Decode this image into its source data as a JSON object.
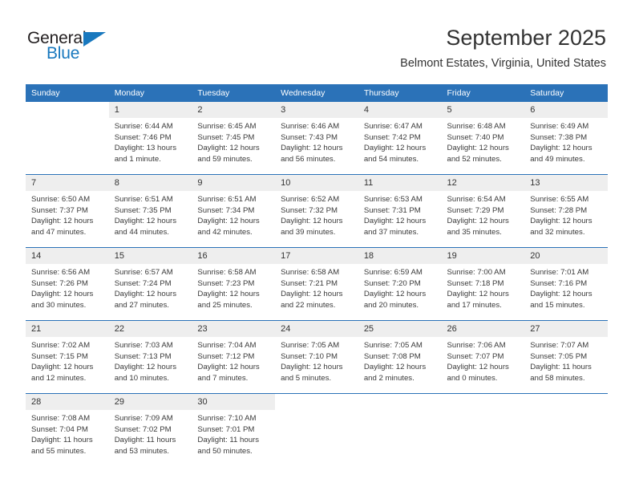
{
  "brand": {
    "name_top": "General",
    "name_bottom": "Blue",
    "triangle_icon": "triangle-logo-icon",
    "color_black": "#231f20",
    "color_blue": "#1878be"
  },
  "header": {
    "title": "September 2025",
    "subtitle": "Belmont Estates, Virginia, United States"
  },
  "theme": {
    "header_bg": "#2b72b8",
    "header_text": "#ffffff",
    "daynum_bg": "#eeeeee",
    "body_text": "#3a3a3a"
  },
  "weekday_headers": [
    "Sunday",
    "Monday",
    "Tuesday",
    "Wednesday",
    "Thursday",
    "Friday",
    "Saturday"
  ],
  "weeks": [
    [
      {
        "day": "",
        "blank": true
      },
      {
        "day": "1",
        "sunrise": "Sunrise: 6:44 AM",
        "sunset": "Sunset: 7:46 PM",
        "daylight_line1": "Daylight: 13 hours",
        "daylight_line2": "and 1 minute."
      },
      {
        "day": "2",
        "sunrise": "Sunrise: 6:45 AM",
        "sunset": "Sunset: 7:45 PM",
        "daylight_line1": "Daylight: 12 hours",
        "daylight_line2": "and 59 minutes."
      },
      {
        "day": "3",
        "sunrise": "Sunrise: 6:46 AM",
        "sunset": "Sunset: 7:43 PM",
        "daylight_line1": "Daylight: 12 hours",
        "daylight_line2": "and 56 minutes."
      },
      {
        "day": "4",
        "sunrise": "Sunrise: 6:47 AM",
        "sunset": "Sunset: 7:42 PM",
        "daylight_line1": "Daylight: 12 hours",
        "daylight_line2": "and 54 minutes."
      },
      {
        "day": "5",
        "sunrise": "Sunrise: 6:48 AM",
        "sunset": "Sunset: 7:40 PM",
        "daylight_line1": "Daylight: 12 hours",
        "daylight_line2": "and 52 minutes."
      },
      {
        "day": "6",
        "sunrise": "Sunrise: 6:49 AM",
        "sunset": "Sunset: 7:38 PM",
        "daylight_line1": "Daylight: 12 hours",
        "daylight_line2": "and 49 minutes."
      }
    ],
    [
      {
        "day": "7",
        "sunrise": "Sunrise: 6:50 AM",
        "sunset": "Sunset: 7:37 PM",
        "daylight_line1": "Daylight: 12 hours",
        "daylight_line2": "and 47 minutes."
      },
      {
        "day": "8",
        "sunrise": "Sunrise: 6:51 AM",
        "sunset": "Sunset: 7:35 PM",
        "daylight_line1": "Daylight: 12 hours",
        "daylight_line2": "and 44 minutes."
      },
      {
        "day": "9",
        "sunrise": "Sunrise: 6:51 AM",
        "sunset": "Sunset: 7:34 PM",
        "daylight_line1": "Daylight: 12 hours",
        "daylight_line2": "and 42 minutes."
      },
      {
        "day": "10",
        "sunrise": "Sunrise: 6:52 AM",
        "sunset": "Sunset: 7:32 PM",
        "daylight_line1": "Daylight: 12 hours",
        "daylight_line2": "and 39 minutes."
      },
      {
        "day": "11",
        "sunrise": "Sunrise: 6:53 AM",
        "sunset": "Sunset: 7:31 PM",
        "daylight_line1": "Daylight: 12 hours",
        "daylight_line2": "and 37 minutes."
      },
      {
        "day": "12",
        "sunrise": "Sunrise: 6:54 AM",
        "sunset": "Sunset: 7:29 PM",
        "daylight_line1": "Daylight: 12 hours",
        "daylight_line2": "and 35 minutes."
      },
      {
        "day": "13",
        "sunrise": "Sunrise: 6:55 AM",
        "sunset": "Sunset: 7:28 PM",
        "daylight_line1": "Daylight: 12 hours",
        "daylight_line2": "and 32 minutes."
      }
    ],
    [
      {
        "day": "14",
        "sunrise": "Sunrise: 6:56 AM",
        "sunset": "Sunset: 7:26 PM",
        "daylight_line1": "Daylight: 12 hours",
        "daylight_line2": "and 30 minutes."
      },
      {
        "day": "15",
        "sunrise": "Sunrise: 6:57 AM",
        "sunset": "Sunset: 7:24 PM",
        "daylight_line1": "Daylight: 12 hours",
        "daylight_line2": "and 27 minutes."
      },
      {
        "day": "16",
        "sunrise": "Sunrise: 6:58 AM",
        "sunset": "Sunset: 7:23 PM",
        "daylight_line1": "Daylight: 12 hours",
        "daylight_line2": "and 25 minutes."
      },
      {
        "day": "17",
        "sunrise": "Sunrise: 6:58 AM",
        "sunset": "Sunset: 7:21 PM",
        "daylight_line1": "Daylight: 12 hours",
        "daylight_line2": "and 22 minutes."
      },
      {
        "day": "18",
        "sunrise": "Sunrise: 6:59 AM",
        "sunset": "Sunset: 7:20 PM",
        "daylight_line1": "Daylight: 12 hours",
        "daylight_line2": "and 20 minutes."
      },
      {
        "day": "19",
        "sunrise": "Sunrise: 7:00 AM",
        "sunset": "Sunset: 7:18 PM",
        "daylight_line1": "Daylight: 12 hours",
        "daylight_line2": "and 17 minutes."
      },
      {
        "day": "20",
        "sunrise": "Sunrise: 7:01 AM",
        "sunset": "Sunset: 7:16 PM",
        "daylight_line1": "Daylight: 12 hours",
        "daylight_line2": "and 15 minutes."
      }
    ],
    [
      {
        "day": "21",
        "sunrise": "Sunrise: 7:02 AM",
        "sunset": "Sunset: 7:15 PM",
        "daylight_line1": "Daylight: 12 hours",
        "daylight_line2": "and 12 minutes."
      },
      {
        "day": "22",
        "sunrise": "Sunrise: 7:03 AM",
        "sunset": "Sunset: 7:13 PM",
        "daylight_line1": "Daylight: 12 hours",
        "daylight_line2": "and 10 minutes."
      },
      {
        "day": "23",
        "sunrise": "Sunrise: 7:04 AM",
        "sunset": "Sunset: 7:12 PM",
        "daylight_line1": "Daylight: 12 hours",
        "daylight_line2": "and 7 minutes."
      },
      {
        "day": "24",
        "sunrise": "Sunrise: 7:05 AM",
        "sunset": "Sunset: 7:10 PM",
        "daylight_line1": "Daylight: 12 hours",
        "daylight_line2": "and 5 minutes."
      },
      {
        "day": "25",
        "sunrise": "Sunrise: 7:05 AM",
        "sunset": "Sunset: 7:08 PM",
        "daylight_line1": "Daylight: 12 hours",
        "daylight_line2": "and 2 minutes."
      },
      {
        "day": "26",
        "sunrise": "Sunrise: 7:06 AM",
        "sunset": "Sunset: 7:07 PM",
        "daylight_line1": "Daylight: 12 hours",
        "daylight_line2": "and 0 minutes."
      },
      {
        "day": "27",
        "sunrise": "Sunrise: 7:07 AM",
        "sunset": "Sunset: 7:05 PM",
        "daylight_line1": "Daylight: 11 hours",
        "daylight_line2": "and 58 minutes."
      }
    ],
    [
      {
        "day": "28",
        "sunrise": "Sunrise: 7:08 AM",
        "sunset": "Sunset: 7:04 PM",
        "daylight_line1": "Daylight: 11 hours",
        "daylight_line2": "and 55 minutes."
      },
      {
        "day": "29",
        "sunrise": "Sunrise: 7:09 AM",
        "sunset": "Sunset: 7:02 PM",
        "daylight_line1": "Daylight: 11 hours",
        "daylight_line2": "and 53 minutes."
      },
      {
        "day": "30",
        "sunrise": "Sunrise: 7:10 AM",
        "sunset": "Sunset: 7:01 PM",
        "daylight_line1": "Daylight: 11 hours",
        "daylight_line2": "and 50 minutes."
      },
      {
        "day": "",
        "blank": true
      },
      {
        "day": "",
        "blank": true
      },
      {
        "day": "",
        "blank": true
      },
      {
        "day": "",
        "blank": true
      }
    ]
  ]
}
